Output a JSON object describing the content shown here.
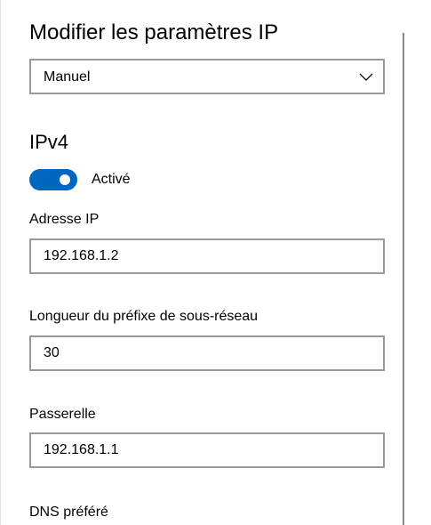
{
  "dialog": {
    "title": "Modifier les paramètres IP",
    "mode_dropdown": {
      "selected": "Manuel",
      "icon": "chevron-down-icon"
    }
  },
  "ipv4": {
    "heading": "IPv4",
    "toggle": {
      "state": "on",
      "label": "Activé",
      "accent_color": "#0067c0"
    },
    "fields": {
      "ip_address": {
        "label": "Adresse IP",
        "value": "192.168.1.2"
      },
      "subnet_prefix": {
        "label": "Longueur du préfixe de sous-réseau",
        "value": "30"
      },
      "gateway": {
        "label": "Passerelle",
        "value": "192.168.1.1"
      },
      "preferred_dns": {
        "label": "DNS préféré"
      }
    }
  },
  "colors": {
    "input_border": "#999999",
    "background": "#ffffff",
    "text": "#000000"
  }
}
